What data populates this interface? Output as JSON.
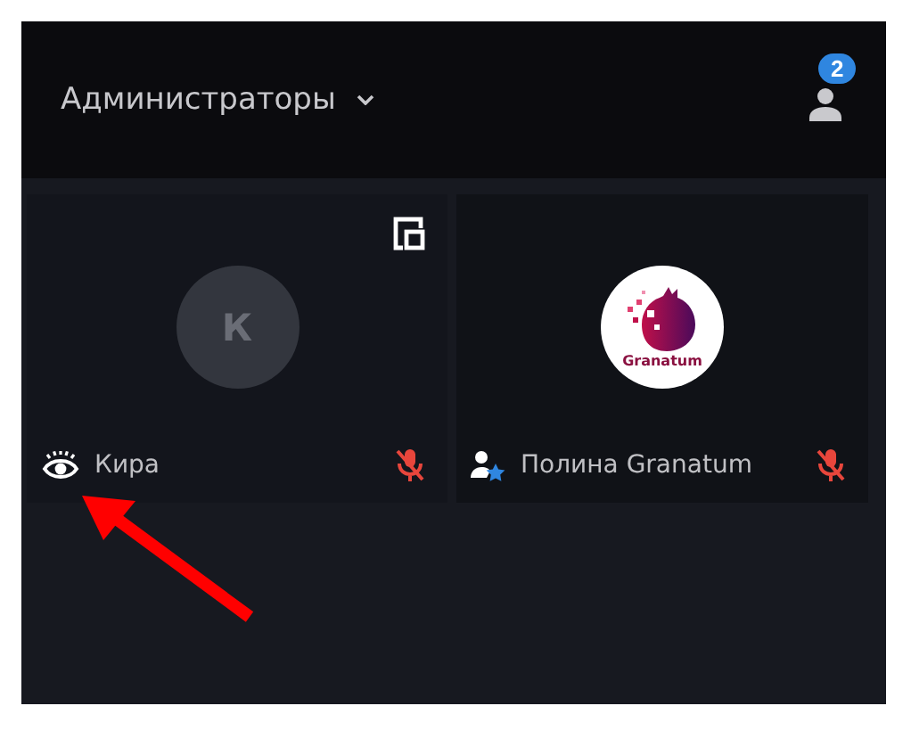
{
  "header": {
    "title": "Администраторы",
    "participants_badge": "2"
  },
  "tiles": [
    {
      "name": "Кира",
      "kind": "viewer",
      "avatar": {
        "kind": "initial",
        "text": "К"
      },
      "muted": true,
      "layout_button": true
    },
    {
      "name": "Полина Granatum",
      "kind": "moderator",
      "avatar": {
        "kind": "logo",
        "text": "Granatum"
      },
      "muted": true,
      "layout_button": false
    }
  ],
  "annotation": {
    "kind": "arrow"
  }
}
